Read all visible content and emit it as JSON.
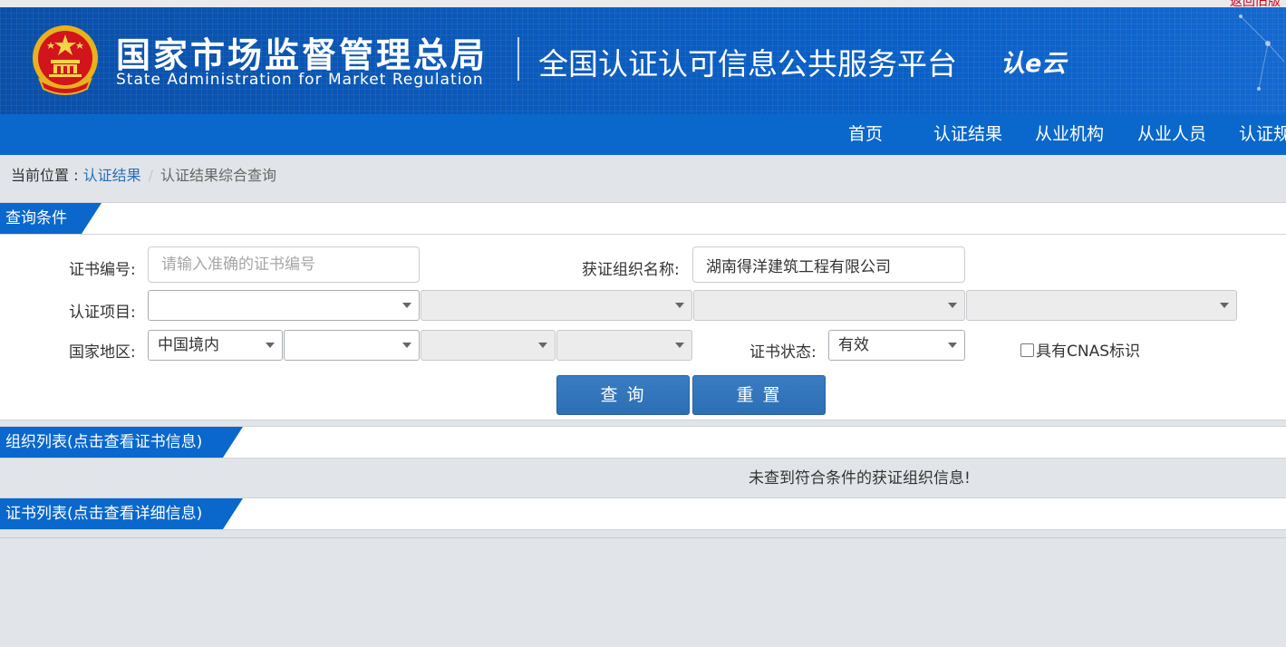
{
  "top_strip": {
    "text": "返回旧版"
  },
  "header": {
    "agency_cn": "国家市场监督管理总局",
    "agency_en": "State Administration  for  Market Regulation",
    "platform_title": "全国认证认可信息公共服务平台",
    "cloud_logo": "认e云",
    "colors": {
      "header_bg": "#0b5bbd",
      "nav_bg": "#0a68cc"
    }
  },
  "nav": {
    "items": [
      {
        "label": "首页"
      },
      {
        "label": "认证结果"
      },
      {
        "label": "从业机构"
      },
      {
        "label": "从业人员"
      },
      {
        "label": "认证规"
      }
    ]
  },
  "breadcrumb": {
    "prefix": "当前位置 : ",
    "link": "认证结果",
    "separator": "/",
    "current": "认证结果综合查询"
  },
  "query_section": {
    "title": "查询条件",
    "cert_no_label": "证书编号:",
    "cert_no_placeholder": "请输入准确的证书编号",
    "cert_no_value": "",
    "org_name_label": "获证组织名称:",
    "org_name_value": "湖南得洋建筑工程有限公司",
    "project_label": "认证项目:",
    "project_selects": [
      "",
      "",
      "",
      ""
    ],
    "region_label": "国家地区:",
    "region_selects": [
      "中国境内",
      "",
      "",
      ""
    ],
    "status_label": "证书状态:",
    "status_value": "有效",
    "cnas_label": "具有CNAS标识",
    "cnas_checked": false,
    "search_button": "查 询",
    "reset_button": "重 置"
  },
  "org_section": {
    "title": "组织列表(点击查看证书信息)",
    "empty_message": "未查到符合条件的获证组织信息!"
  },
  "cert_section": {
    "title": "证书列表(点击查看详细信息)"
  },
  "colors": {
    "accent": "#0a68cc",
    "link": "#2a6fb8",
    "button": "#2c6fb5",
    "page_bg": "#e1e5e9"
  }
}
